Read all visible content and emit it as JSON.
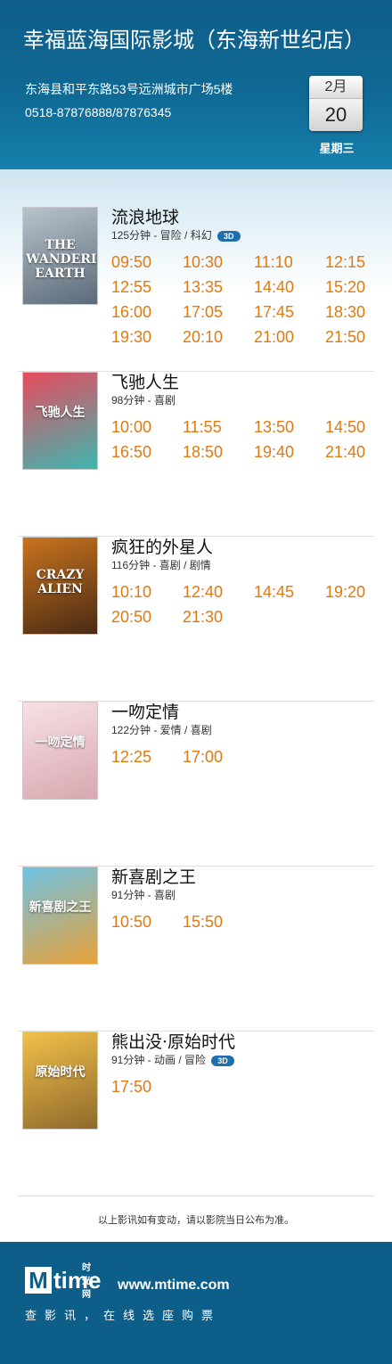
{
  "header": {
    "cinema_name": "幸福蓝海国际影城（东海新世纪店）",
    "address": "东海县和平东路53号远洲城市广场5楼",
    "phone": "0518-87876888/87876345",
    "month": "2月",
    "day": "20",
    "weekday": "星期三"
  },
  "movies": [
    {
      "title": "流浪地球",
      "meta": "125分钟 - 冒险 / 科幻",
      "is_3d": true,
      "badge": "3D",
      "poster_text": "THE WANDERING EARTH",
      "poster_colors": [
        "#b8c3cc",
        "#5b6b79"
      ],
      "times": [
        "09:50",
        "10:30",
        "11:10",
        "12:15",
        "12:55",
        "13:35",
        "14:40",
        "15:20",
        "16:00",
        "17:05",
        "17:45",
        "18:30",
        "19:30",
        "20:10",
        "21:00",
        "21:50"
      ]
    },
    {
      "title": "飞驰人生",
      "meta": "98分钟 - 喜剧",
      "is_3d": false,
      "poster_text": "飞驰人生",
      "poster_colors": [
        "#e74b5e",
        "#3fb6b0"
      ],
      "times": [
        "10:00",
        "11:55",
        "13:50",
        "14:50",
        "16:50",
        "18:50",
        "19:40",
        "21:40"
      ]
    },
    {
      "title": "疯狂的外星人",
      "meta": "116分钟 - 喜剧 / 剧情",
      "is_3d": false,
      "poster_text": "CRAZY ALIEN",
      "poster_colors": [
        "#c9741e",
        "#4a2a14"
      ],
      "times": [
        "10:10",
        "12:40",
        "14:45",
        "19:20",
        "20:50",
        "21:30"
      ]
    },
    {
      "title": "一吻定情",
      "meta": "122分钟 - 爱情 / 喜剧",
      "is_3d": false,
      "poster_text": "一吻定情",
      "poster_colors": [
        "#f6e1e4",
        "#d9a7b0"
      ],
      "times": [
        "12:25",
        "17:00"
      ]
    },
    {
      "title": "新喜剧之王",
      "meta": "91分钟 - 喜剧",
      "is_3d": false,
      "poster_text": "新喜剧之王",
      "poster_colors": [
        "#6fc2e3",
        "#e7a13a"
      ],
      "times": [
        "10:50",
        "15:50"
      ]
    },
    {
      "title": "熊出没·原始时代",
      "meta": "91分钟 - 动画 / 冒险",
      "is_3d": true,
      "badge": "3D",
      "poster_text": "原始时代",
      "poster_colors": [
        "#f2c04a",
        "#8f6a2c"
      ],
      "times": [
        "17:50"
      ]
    }
  ],
  "notice": "以上影讯如有变动，请以影院当日公布为准。",
  "footer": {
    "logo_m": "M",
    "logo_word": "time",
    "logo_small": "时光网",
    "url": "www.mtime.com",
    "slogan": "查影讯，在线选座购票"
  }
}
